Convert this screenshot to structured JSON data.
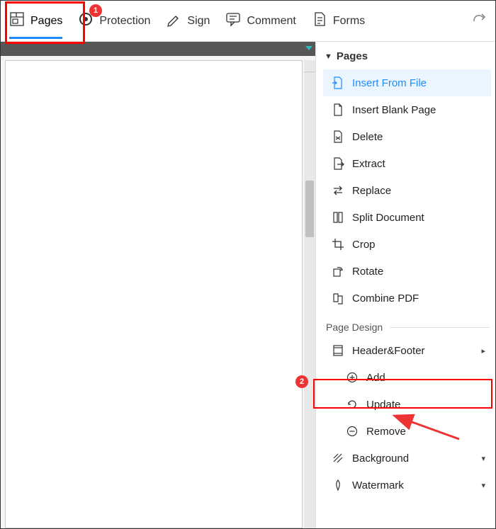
{
  "annotations": {
    "badge1": "1",
    "badge2": "2"
  },
  "toolbar": {
    "pages": "Pages",
    "protection": "Protection",
    "sign": "Sign",
    "comment": "Comment",
    "forms": "Forms"
  },
  "panel": {
    "title": "Pages",
    "items": {
      "insert_from_file": "Insert From File",
      "insert_blank": "Insert Blank Page",
      "delete": "Delete",
      "extract": "Extract",
      "replace": "Replace",
      "split": "Split Document",
      "crop": "Crop",
      "rotate": "Rotate",
      "combine": "Combine PDF"
    },
    "design_label": "Page Design",
    "design": {
      "header_footer": "Header&Footer",
      "add": "Add",
      "update": "Update",
      "remove": "Remove",
      "background": "Background",
      "watermark": "Watermark"
    }
  }
}
